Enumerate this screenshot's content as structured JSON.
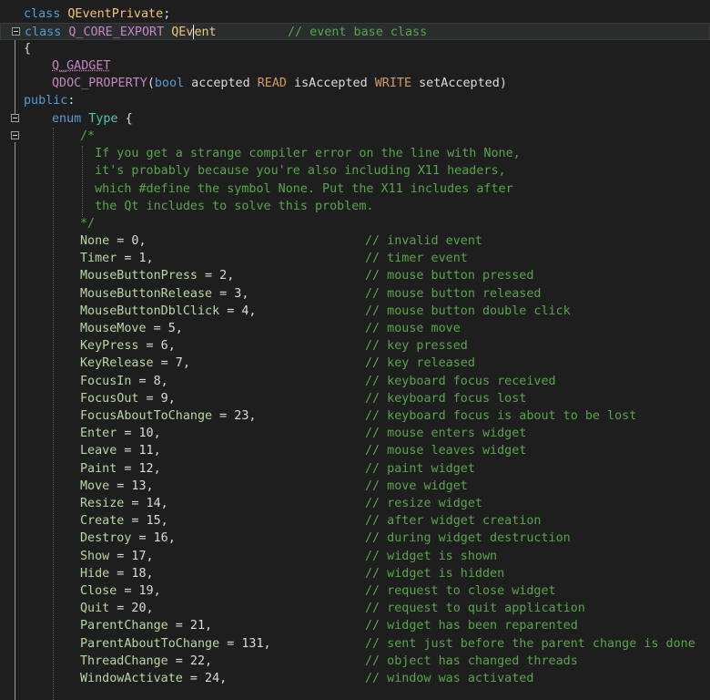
{
  "editor": {
    "colors": {
      "background": "#1e1e1e",
      "keyword": "#569cd6",
      "enum_member": "#b8d7a3",
      "comment": "#57a64a",
      "macro": "#c586c0",
      "class": "#f0c674"
    },
    "line1": {
      "kw": "class",
      "name": "QEventPrivate",
      "tail": ";"
    },
    "line2": {
      "kw": "class",
      "macro": "Q_CORE_EXPORT",
      "name_a": "QEv",
      "name_b": "ent",
      "comment": "// event base class"
    },
    "line3": {
      "text": "{"
    },
    "line4": {
      "macro": "Q_GADGET"
    },
    "line5": {
      "macro": "QDOC_PROPERTY",
      "open": "(",
      "t1": "bool",
      "t2": " accepted ",
      "t3": "READ",
      "t4": " isAccepted ",
      "t5": "WRITE",
      "t6": " setAccepted",
      "close": ")"
    },
    "line6": {
      "kw": "public",
      "tail": ":"
    },
    "line7": {
      "kw": "enum",
      "name": "Type",
      "tail": " {"
    },
    "comment_block": [
      "/*",
      "  If you get a strange compiler error on the line with None,",
      "  it's probably because you're also including X11 headers,",
      "  which #define the symbol None. Put the X11 includes after",
      "  the Qt includes to solve this problem.",
      "*/"
    ],
    "enum_rows": [
      {
        "name": "None",
        "value": " = 0,",
        "comment": "// invalid event"
      },
      {
        "name": "Timer",
        "value": " = 1,",
        "comment": "// timer event"
      },
      {
        "name": "MouseButtonPress",
        "value": " = 2,",
        "comment": "// mouse button pressed"
      },
      {
        "name": "MouseButtonRelease",
        "value": " = 3,",
        "comment": "// mouse button released"
      },
      {
        "name": "MouseButtonDblClick",
        "value": " = 4,",
        "comment": "// mouse button double click"
      },
      {
        "name": "MouseMove",
        "value": " = 5,",
        "comment": "// mouse move"
      },
      {
        "name": "KeyPress",
        "value": " = 6,",
        "comment": "// key pressed"
      },
      {
        "name": "KeyRelease",
        "value": " = 7,",
        "comment": "// key released"
      },
      {
        "name": "FocusIn",
        "value": " = 8,",
        "comment": "// keyboard focus received"
      },
      {
        "name": "FocusOut",
        "value": " = 9,",
        "comment": "// keyboard focus lost"
      },
      {
        "name": "FocusAboutToChange",
        "value": " = 23,",
        "comment": "// keyboard focus is about to be lost"
      },
      {
        "name": "Enter",
        "value": " = 10,",
        "comment": "// mouse enters widget"
      },
      {
        "name": "Leave",
        "value": " = 11,",
        "comment": "// mouse leaves widget"
      },
      {
        "name": "Paint",
        "value": " = 12,",
        "comment": "// paint widget"
      },
      {
        "name": "Move",
        "value": " = 13,",
        "comment": "// move widget"
      },
      {
        "name": "Resize",
        "value": " = 14,",
        "comment": "// resize widget"
      },
      {
        "name": "Create",
        "value": " = 15,",
        "comment": "// after widget creation"
      },
      {
        "name": "Destroy",
        "value": " = 16,",
        "comment": "// during widget destruction"
      },
      {
        "name": "Show",
        "value": " = 17,",
        "comment": "// widget is shown"
      },
      {
        "name": "Hide",
        "value": " = 18,",
        "comment": "// widget is hidden"
      },
      {
        "name": "Close",
        "value": " = 19,",
        "comment": "// request to close widget"
      },
      {
        "name": "Quit",
        "value": " = 20,",
        "comment": "// request to quit application"
      },
      {
        "name": "ParentChange",
        "value": " = 21,",
        "comment": "// widget has been reparented"
      },
      {
        "name": "ParentAboutToChange",
        "value": " = 131,",
        "comment": "// sent just before the parent change is done"
      },
      {
        "name": "ThreadChange",
        "value": " = 22,",
        "comment": "// object has changed threads"
      },
      {
        "name": "WindowActivate",
        "value": " = 24,",
        "comment": "// window was activated"
      }
    ]
  }
}
